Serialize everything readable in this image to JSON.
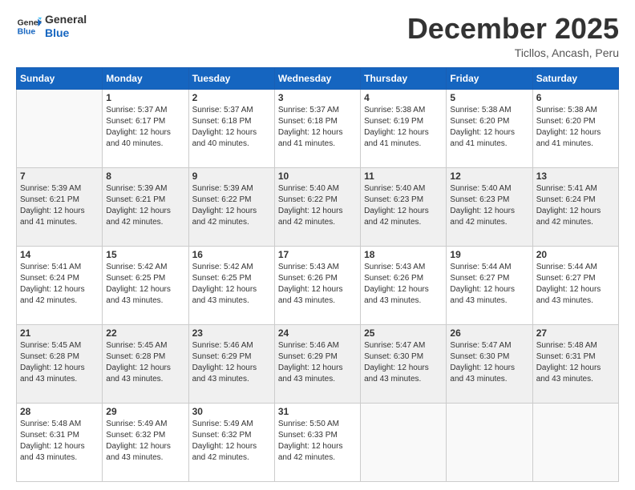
{
  "logo": {
    "line1": "General",
    "line2": "Blue"
  },
  "header": {
    "title": "December 2025",
    "subtitle": "Ticllos, Ancash, Peru"
  },
  "weekdays": [
    "Sunday",
    "Monday",
    "Tuesday",
    "Wednesday",
    "Thursday",
    "Friday",
    "Saturday"
  ],
  "weeks": [
    [
      {
        "day": "",
        "sunrise": "",
        "sunset": "",
        "daylight": ""
      },
      {
        "day": "1",
        "sunrise": "Sunrise: 5:37 AM",
        "sunset": "Sunset: 6:17 PM",
        "daylight": "Daylight: 12 hours and 40 minutes."
      },
      {
        "day": "2",
        "sunrise": "Sunrise: 5:37 AM",
        "sunset": "Sunset: 6:18 PM",
        "daylight": "Daylight: 12 hours and 40 minutes."
      },
      {
        "day": "3",
        "sunrise": "Sunrise: 5:37 AM",
        "sunset": "Sunset: 6:18 PM",
        "daylight": "Daylight: 12 hours and 41 minutes."
      },
      {
        "day": "4",
        "sunrise": "Sunrise: 5:38 AM",
        "sunset": "Sunset: 6:19 PM",
        "daylight": "Daylight: 12 hours and 41 minutes."
      },
      {
        "day": "5",
        "sunrise": "Sunrise: 5:38 AM",
        "sunset": "Sunset: 6:20 PM",
        "daylight": "Daylight: 12 hours and 41 minutes."
      },
      {
        "day": "6",
        "sunrise": "Sunrise: 5:38 AM",
        "sunset": "Sunset: 6:20 PM",
        "daylight": "Daylight: 12 hours and 41 minutes."
      }
    ],
    [
      {
        "day": "7",
        "sunrise": "Sunrise: 5:39 AM",
        "sunset": "Sunset: 6:21 PM",
        "daylight": "Daylight: 12 hours and 41 minutes."
      },
      {
        "day": "8",
        "sunrise": "Sunrise: 5:39 AM",
        "sunset": "Sunset: 6:21 PM",
        "daylight": "Daylight: 12 hours and 42 minutes."
      },
      {
        "day": "9",
        "sunrise": "Sunrise: 5:39 AM",
        "sunset": "Sunset: 6:22 PM",
        "daylight": "Daylight: 12 hours and 42 minutes."
      },
      {
        "day": "10",
        "sunrise": "Sunrise: 5:40 AM",
        "sunset": "Sunset: 6:22 PM",
        "daylight": "Daylight: 12 hours and 42 minutes."
      },
      {
        "day": "11",
        "sunrise": "Sunrise: 5:40 AM",
        "sunset": "Sunset: 6:23 PM",
        "daylight": "Daylight: 12 hours and 42 minutes."
      },
      {
        "day": "12",
        "sunrise": "Sunrise: 5:40 AM",
        "sunset": "Sunset: 6:23 PM",
        "daylight": "Daylight: 12 hours and 42 minutes."
      },
      {
        "day": "13",
        "sunrise": "Sunrise: 5:41 AM",
        "sunset": "Sunset: 6:24 PM",
        "daylight": "Daylight: 12 hours and 42 minutes."
      }
    ],
    [
      {
        "day": "14",
        "sunrise": "Sunrise: 5:41 AM",
        "sunset": "Sunset: 6:24 PM",
        "daylight": "Daylight: 12 hours and 42 minutes."
      },
      {
        "day": "15",
        "sunrise": "Sunrise: 5:42 AM",
        "sunset": "Sunset: 6:25 PM",
        "daylight": "Daylight: 12 hours and 43 minutes."
      },
      {
        "day": "16",
        "sunrise": "Sunrise: 5:42 AM",
        "sunset": "Sunset: 6:25 PM",
        "daylight": "Daylight: 12 hours and 43 minutes."
      },
      {
        "day": "17",
        "sunrise": "Sunrise: 5:43 AM",
        "sunset": "Sunset: 6:26 PM",
        "daylight": "Daylight: 12 hours and 43 minutes."
      },
      {
        "day": "18",
        "sunrise": "Sunrise: 5:43 AM",
        "sunset": "Sunset: 6:26 PM",
        "daylight": "Daylight: 12 hours and 43 minutes."
      },
      {
        "day": "19",
        "sunrise": "Sunrise: 5:44 AM",
        "sunset": "Sunset: 6:27 PM",
        "daylight": "Daylight: 12 hours and 43 minutes."
      },
      {
        "day": "20",
        "sunrise": "Sunrise: 5:44 AM",
        "sunset": "Sunset: 6:27 PM",
        "daylight": "Daylight: 12 hours and 43 minutes."
      }
    ],
    [
      {
        "day": "21",
        "sunrise": "Sunrise: 5:45 AM",
        "sunset": "Sunset: 6:28 PM",
        "daylight": "Daylight: 12 hours and 43 minutes."
      },
      {
        "day": "22",
        "sunrise": "Sunrise: 5:45 AM",
        "sunset": "Sunset: 6:28 PM",
        "daylight": "Daylight: 12 hours and 43 minutes."
      },
      {
        "day": "23",
        "sunrise": "Sunrise: 5:46 AM",
        "sunset": "Sunset: 6:29 PM",
        "daylight": "Daylight: 12 hours and 43 minutes."
      },
      {
        "day": "24",
        "sunrise": "Sunrise: 5:46 AM",
        "sunset": "Sunset: 6:29 PM",
        "daylight": "Daylight: 12 hours and 43 minutes."
      },
      {
        "day": "25",
        "sunrise": "Sunrise: 5:47 AM",
        "sunset": "Sunset: 6:30 PM",
        "daylight": "Daylight: 12 hours and 43 minutes."
      },
      {
        "day": "26",
        "sunrise": "Sunrise: 5:47 AM",
        "sunset": "Sunset: 6:30 PM",
        "daylight": "Daylight: 12 hours and 43 minutes."
      },
      {
        "day": "27",
        "sunrise": "Sunrise: 5:48 AM",
        "sunset": "Sunset: 6:31 PM",
        "daylight": "Daylight: 12 hours and 43 minutes."
      }
    ],
    [
      {
        "day": "28",
        "sunrise": "Sunrise: 5:48 AM",
        "sunset": "Sunset: 6:31 PM",
        "daylight": "Daylight: 12 hours and 43 minutes."
      },
      {
        "day": "29",
        "sunrise": "Sunrise: 5:49 AM",
        "sunset": "Sunset: 6:32 PM",
        "daylight": "Daylight: 12 hours and 43 minutes."
      },
      {
        "day": "30",
        "sunrise": "Sunrise: 5:49 AM",
        "sunset": "Sunset: 6:32 PM",
        "daylight": "Daylight: 12 hours and 42 minutes."
      },
      {
        "day": "31",
        "sunrise": "Sunrise: 5:50 AM",
        "sunset": "Sunset: 6:33 PM",
        "daylight": "Daylight: 12 hours and 42 minutes."
      },
      {
        "day": "",
        "sunrise": "",
        "sunset": "",
        "daylight": ""
      },
      {
        "day": "",
        "sunrise": "",
        "sunset": "",
        "daylight": ""
      },
      {
        "day": "",
        "sunrise": "",
        "sunset": "",
        "daylight": ""
      }
    ]
  ]
}
